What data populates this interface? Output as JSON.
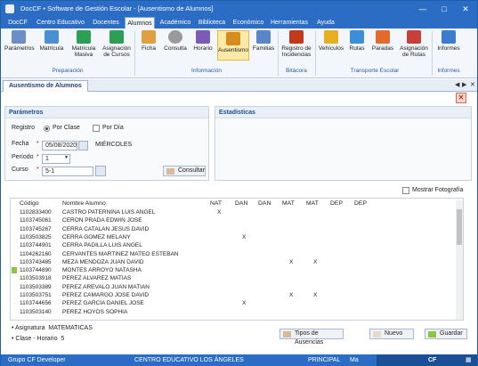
{
  "window": {
    "title": "DocCF • Software de Gestión Escolar - [Ausentismo de Alumnos]"
  },
  "menu": [
    "DocCF",
    "Centro Educativo",
    "Docentes",
    "Alumnos",
    "Académico",
    "Biblioteca",
    "Económico",
    "Herramientas",
    "Ayuda"
  ],
  "ribbon": {
    "buttons": [
      {
        "label": "Parámetros",
        "icon": "settings-icon",
        "color": "#6b8ec9"
      },
      {
        "label": "Matrícula",
        "icon": "user-add-icon",
        "color": "#4a8fd0"
      },
      {
        "label": "Matrícula Masiva",
        "icon": "users-add-icon",
        "color": "#2f9e55"
      },
      {
        "label": "Asignación de Cursos",
        "icon": "users-group-icon",
        "color": "#2f9e55"
      },
      {
        "label": "Ficha",
        "icon": "profile-icon",
        "color": "#e0a040"
      },
      {
        "label": "Consulta",
        "icon": "magnifier-icon",
        "color": "#808080"
      },
      {
        "label": "Horario",
        "icon": "schedule-icon",
        "color": "#7b5bb6"
      },
      {
        "label": "Ausentismo",
        "icon": "attendance-icon",
        "color": "#d98c1e"
      },
      {
        "label": "Familias",
        "icon": "family-icon",
        "color": "#5a86c5"
      },
      {
        "label": "Registro de Incidencias",
        "icon": "incident-icon",
        "color": "#c23a1a"
      },
      {
        "label": "Vehículos",
        "icon": "bus-icon",
        "color": "#e6b020"
      },
      {
        "label": "Rutas",
        "icon": "route-icon",
        "color": "#3c8fd6"
      },
      {
        "label": "Paradas",
        "icon": "map-pin-icon",
        "color": "#e26a2c"
      },
      {
        "label": "Asignación de Rutas",
        "icon": "route-assign-icon",
        "color": "#c9403a"
      },
      {
        "label": "Informes",
        "icon": "report-icon",
        "color": "#3c7bd0"
      }
    ],
    "groups": [
      "Preparación",
      "Información",
      "Bitácora",
      "Transporte Escolar",
      "Informes"
    ]
  },
  "tab": {
    "label": "Ausentismo de Alumnos"
  },
  "parametros": {
    "title": "Parámetros",
    "registro_label": "Registro",
    "por_clase": "Por Clase",
    "por_dia": "Por Día",
    "fecha_label": "Fecha",
    "fecha_value": "05/08/2020",
    "fecha_day": "MIÉRCOLES",
    "periodo_label": "Período",
    "periodo_value": "1",
    "curso_label": "Curso",
    "curso_value": "5-1",
    "consultar": "Consultar"
  },
  "estadisticas": {
    "title": "Estadísticas"
  },
  "mostrar_fotografia": "Mostrar Fotografía",
  "table": {
    "headers": [
      "Código",
      "Nombre Alumno",
      "NAT",
      "DAN",
      "DAN",
      "MAT",
      "MAT",
      "DEP",
      "DEP"
    ],
    "rows": [
      {
        "codigo": "1102833400",
        "nombre": "CASTRO PATERNINA LUIS ANGEL",
        "marks": [
          "X",
          "",
          "",
          "",
          "",
          "",
          ""
        ]
      },
      {
        "codigo": "1103745061",
        "nombre": "CERON PRADA EDWIN JOSE",
        "marks": [
          "",
          "",
          "",
          "",
          "",
          "",
          ""
        ]
      },
      {
        "codigo": "1103745267",
        "nombre": "CERRA CATALAN JESUS DAVID",
        "marks": [
          "",
          "",
          "",
          "",
          "",
          "",
          ""
        ]
      },
      {
        "codigo": "1103503825",
        "nombre": "CERRA GOMEZ MELANY",
        "marks": [
          "",
          "X",
          "",
          "",
          "",
          "",
          ""
        ]
      },
      {
        "codigo": "1103744901",
        "nombre": "CERRA PADILLA LUIS ANGEL",
        "marks": [
          "",
          "",
          "",
          "",
          "",
          "",
          ""
        ]
      },
      {
        "codigo": "1104262160",
        "nombre": "CERVANTES MARTINEZ MATEO ESTEBAN",
        "marks": [
          "",
          "",
          "",
          "",
          "",
          "",
          ""
        ]
      },
      {
        "codigo": "1103743485",
        "nombre": "MEZA MENDOZA JUAN DAVID",
        "marks": [
          "",
          "",
          "",
          "X",
          "X",
          "",
          ""
        ]
      },
      {
        "codigo": "1103744890",
        "nombre": "MONTES ARROYO NATASHA",
        "marks": [
          "",
          "",
          "",
          "",
          "",
          "",
          ""
        ]
      },
      {
        "codigo": "1103503918",
        "nombre": "PEREZ ALVAREZ MATIAS",
        "marks": [
          "",
          "",
          "",
          "",
          "",
          "",
          ""
        ]
      },
      {
        "codigo": "1103503389",
        "nombre": "PEREZ AREVALO JUAN MATIAN",
        "marks": [
          "",
          "",
          "",
          "",
          "",
          "",
          ""
        ]
      },
      {
        "codigo": "1103503751",
        "nombre": "PEREZ CAMARGO JOSE DAVID",
        "marks": [
          "",
          "",
          "",
          "X",
          "X",
          "",
          ""
        ]
      },
      {
        "codigo": "1103744656",
        "nombre": "PEREZ GARCIA DANIEL JOSE",
        "marks": [
          "",
          "X",
          "",
          "",
          "",
          "",
          ""
        ]
      },
      {
        "codigo": "1103503140",
        "nombre": "PEREZ HOYOS SOPHIA",
        "marks": [
          "",
          "",
          "",
          "",
          "",
          "",
          ""
        ]
      }
    ]
  },
  "footer": {
    "asignatura_label": "Asignatura",
    "asignatura_value": "MATEMATICAS",
    "clase_label": "Clase - Horario",
    "clase_value": "5",
    "tipos": "Tipos de Ausencias",
    "nuevo": "Nuevo",
    "guardar": "Guardar"
  },
  "status": {
    "grupo": "Grupo CF Developer",
    "centro": "CENTRO EDUCATIVO LOS ÁNGELES",
    "rol": "PRINCIPAL",
    "user": "Ma",
    "brand": "CF"
  },
  "colors": {
    "accent": "#2b6cc4",
    "selected_row": "#8cc63f"
  }
}
